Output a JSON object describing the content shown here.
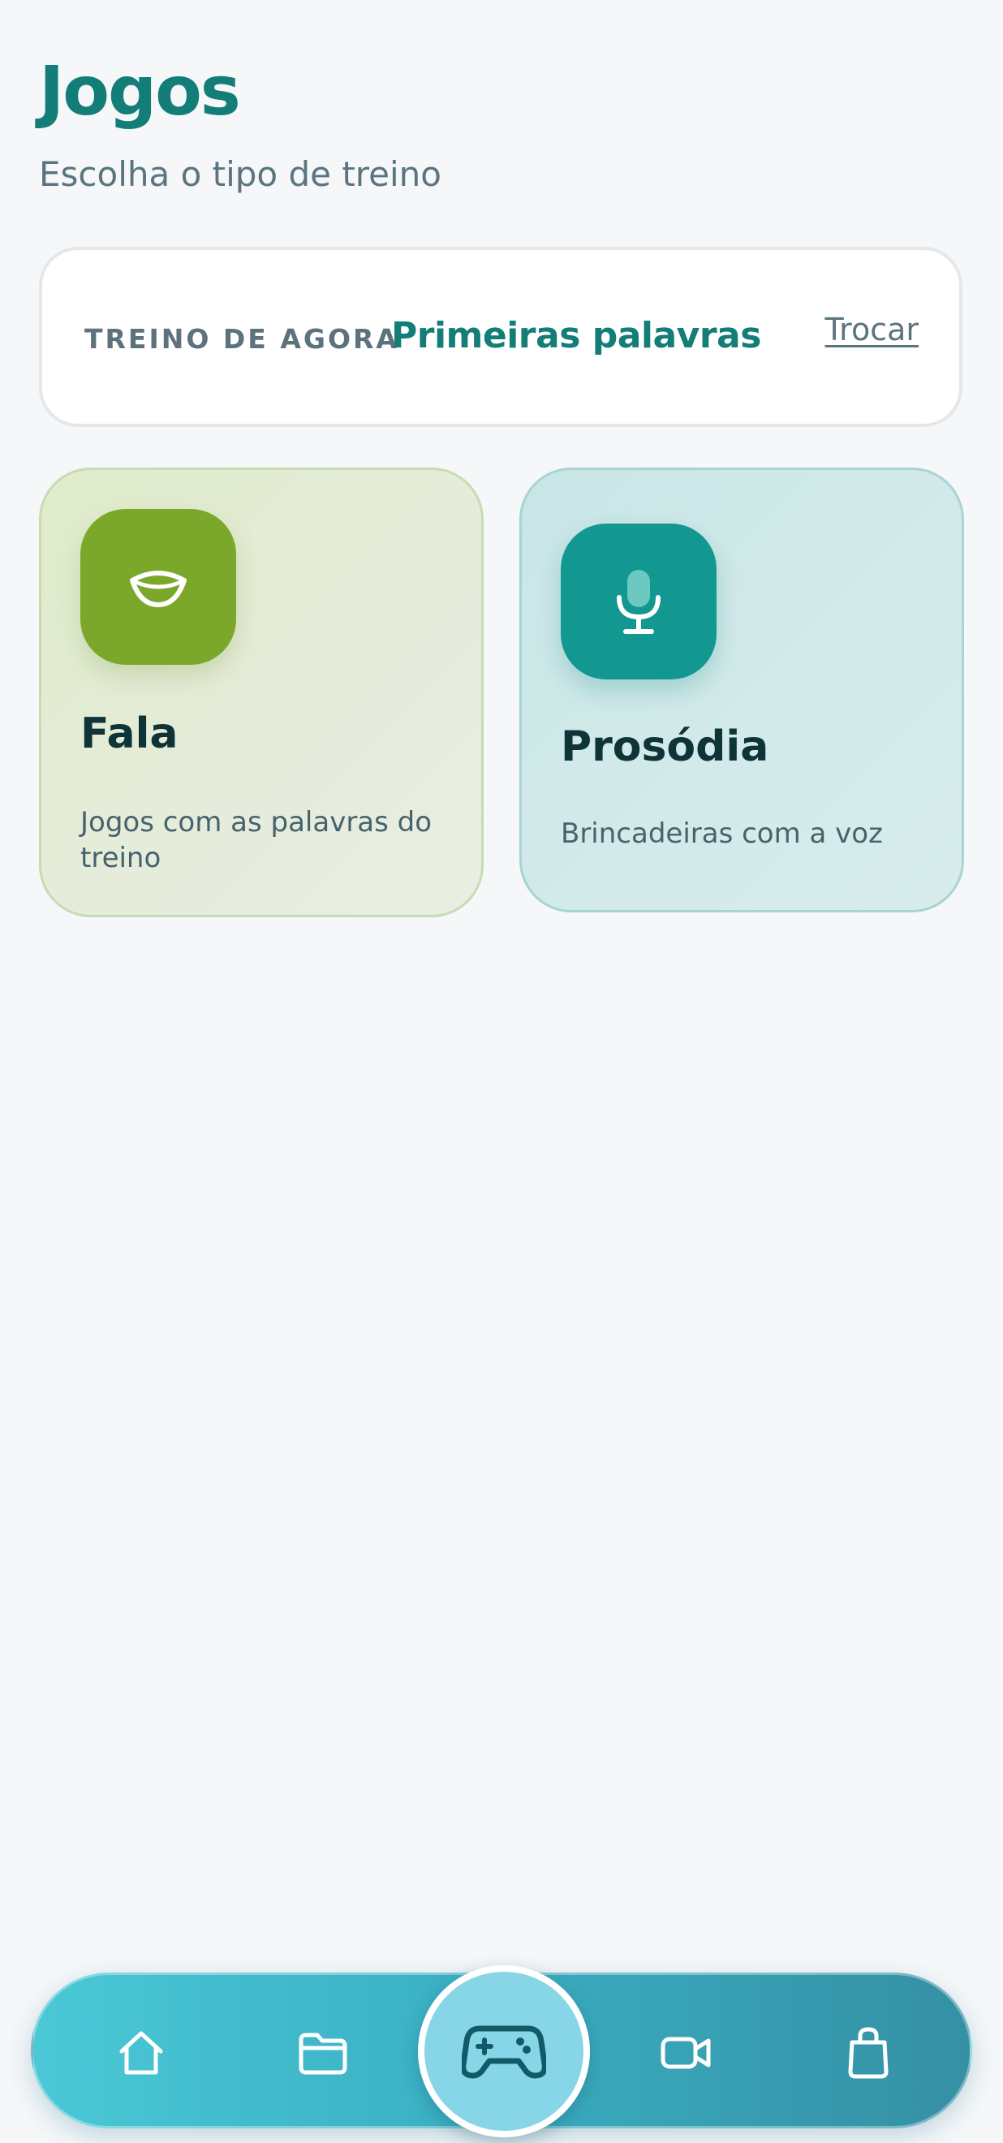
{
  "header": {
    "title": "Jogos",
    "subtitle": "Escolha o tipo de treino"
  },
  "current_training": {
    "label": "TREINO DE AGORA",
    "value": "Primeiras palavras",
    "action": "Trocar"
  },
  "games": [
    {
      "title": "Fala",
      "description": "Jogos com as palavras do treino",
      "icon": "mouth-icon",
      "accent": "#7ba82a"
    },
    {
      "title": "Prosódia",
      "description": "Brincadeiras com a voz",
      "icon": "microphone-icon",
      "accent": "#129891"
    }
  ],
  "nav": {
    "items": [
      {
        "icon": "home-icon"
      },
      {
        "icon": "folder-icon"
      },
      {
        "icon": "gamepad-icon",
        "active": true
      },
      {
        "icon": "video-camera-icon"
      },
      {
        "icon": "shopping-bag-icon"
      }
    ]
  },
  "colors": {
    "brand": "#137d78",
    "background": "#f5f7f9",
    "nav_gradient_start": "#4ac8d6",
    "nav_gradient_end": "#3590a4"
  }
}
